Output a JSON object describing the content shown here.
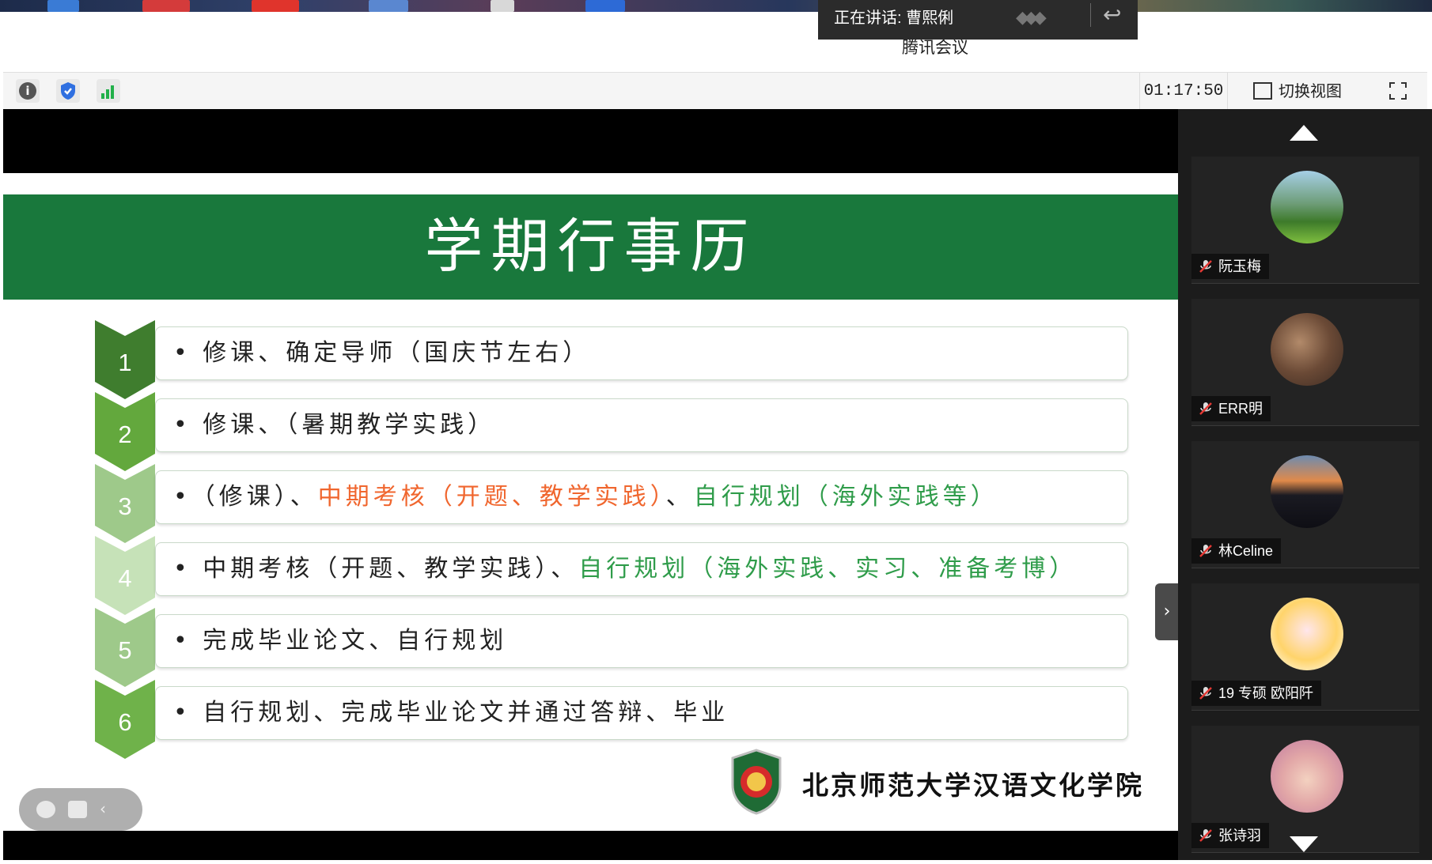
{
  "top_banner": {
    "speaking_label": "正在讲话: 曹熙俐",
    "meeting_title": "腾讯会议"
  },
  "toolbar": {
    "timer": "01:17:50",
    "switch_view_label": "切换视图"
  },
  "slide": {
    "title": "学期行事历",
    "steps": [
      {
        "number": "1",
        "segments": [
          {
            "text": "• 修课、确定导师（国庆节左右）",
            "color": "black"
          }
        ]
      },
      {
        "number": "2",
        "segments": [
          {
            "text": "• 修课、（暑期教学实践）",
            "color": "black"
          }
        ]
      },
      {
        "number": "3",
        "segments": [
          {
            "text": "•（修课）、",
            "color": "black"
          },
          {
            "text": "中期考核（开题、教学实践）",
            "color": "orange"
          },
          {
            "text": "、",
            "color": "black"
          },
          {
            "text": "自行规划（海外实践等）",
            "color": "green"
          }
        ]
      },
      {
        "number": "4",
        "segments": [
          {
            "text": "• 中期考核（开题、教学实践）、",
            "color": "black"
          },
          {
            "text": "自行规划（海外实践、实习、准备考博）",
            "color": "green"
          }
        ]
      },
      {
        "number": "5",
        "segments": [
          {
            "text": "• 完成毕业论文、自行规划",
            "color": "black"
          }
        ]
      },
      {
        "number": "6",
        "segments": [
          {
            "text": "• 自行规划、完成毕业论文并通过答辩、毕业",
            "color": "black"
          }
        ]
      }
    ],
    "school_name": "北京师范大学汉语文化学院"
  },
  "participants": [
    {
      "name": "阮玉梅",
      "avatar": "landscape-avatar"
    },
    {
      "name": "ERR明",
      "avatar": "people-photo-avatar"
    },
    {
      "name": "林Celine",
      "avatar": "sunset-avatar"
    },
    {
      "name": "19 专硕 欧阳阡",
      "avatar": "cartoon-girl-avatar"
    },
    {
      "name": "张诗羽",
      "avatar": "cartoon-doll-avatar"
    }
  ],
  "colors": {
    "title_green": "#19783c",
    "accent_orange": "#f0662e",
    "accent_green": "#2f9c4a"
  }
}
